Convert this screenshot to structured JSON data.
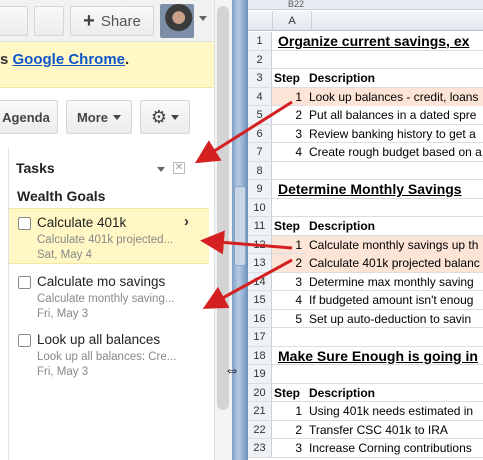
{
  "topbar": {
    "share_label": "Share",
    "share_icon": "+"
  },
  "banner": {
    "prefix": "s ",
    "link_text": "Google Chrome",
    "suffix": "."
  },
  "toolbar": {
    "agenda_label": "Agenda",
    "more_label": "More",
    "gear_icon": "⚙"
  },
  "tasks": {
    "title": "Tasks",
    "close_glyph": "✕",
    "list_title": "Wealth Goals",
    "items": [
      {
        "title": "Calculate 401k",
        "notes": "Calculate 401k projected...",
        "date": "Sat, May 4",
        "active": true,
        "arrow": "›"
      },
      {
        "title": "Calculate mo savings",
        "notes": "Calculate monthly saving...",
        "date": "Fri, May 3",
        "active": false
      },
      {
        "title": "Look up all balances",
        "notes": "Look up all balances: Cre...",
        "date": "Fri, May 3",
        "active": false
      }
    ]
  },
  "sheet": {
    "name_box": "B22",
    "column_header": "A",
    "rows": [
      {
        "num": "1",
        "type": "section",
        "text": "Organize current savings, ex"
      },
      {
        "num": "2",
        "type": "blank"
      },
      {
        "num": "3",
        "type": "header",
        "step": "Step",
        "desc": "Description"
      },
      {
        "num": "4",
        "type": "item",
        "step": "1",
        "desc": "Look up balances - credit, loans",
        "highlight": true
      },
      {
        "num": "5",
        "type": "item",
        "step": "2",
        "desc": "Put all balances in a dated spre"
      },
      {
        "num": "6",
        "type": "item",
        "step": "3",
        "desc": "Review banking history to get a"
      },
      {
        "num": "7",
        "type": "item",
        "step": "4",
        "desc": "Create rough budget based on a"
      },
      {
        "num": "8",
        "type": "blank"
      },
      {
        "num": "9",
        "type": "section",
        "text": "Determine Monthly Savings"
      },
      {
        "num": "10",
        "type": "blank"
      },
      {
        "num": "11",
        "type": "header",
        "step": "Step",
        "desc": "Description"
      },
      {
        "num": "12",
        "type": "item",
        "step": "1",
        "desc": "Calculate monthly savings up th",
        "highlight": true
      },
      {
        "num": "13",
        "type": "item",
        "step": "2",
        "desc": "Calculate 401k projected balanc",
        "highlight": true
      },
      {
        "num": "14",
        "type": "item",
        "step": "3",
        "desc": "Determine max monthly saving"
      },
      {
        "num": "15",
        "type": "item",
        "step": "4",
        "desc": "If budgeted amount isn't enoug"
      },
      {
        "num": "16",
        "type": "item",
        "step": "5",
        "desc": "Set up auto-deduction to savin"
      },
      {
        "num": "17",
        "type": "blank"
      },
      {
        "num": "18",
        "type": "section",
        "text": "Make Sure Enough is going in"
      },
      {
        "num": "19",
        "type": "blank"
      },
      {
        "num": "20",
        "type": "header",
        "step": "Step",
        "desc": "Description"
      },
      {
        "num": "21",
        "type": "item",
        "step": "1",
        "desc": "Using 401k needs estimated in"
      },
      {
        "num": "22",
        "type": "item",
        "step": "2",
        "desc": "Transfer CSC 401k to IRA"
      },
      {
        "num": "23",
        "type": "item",
        "step": "3",
        "desc": "Increase Corning contributions"
      }
    ]
  },
  "colors": {
    "link": "#1155cc",
    "banner_bg": "#fff8c4",
    "row_highlight": "#fce4d6",
    "arrow": "#d42020"
  }
}
